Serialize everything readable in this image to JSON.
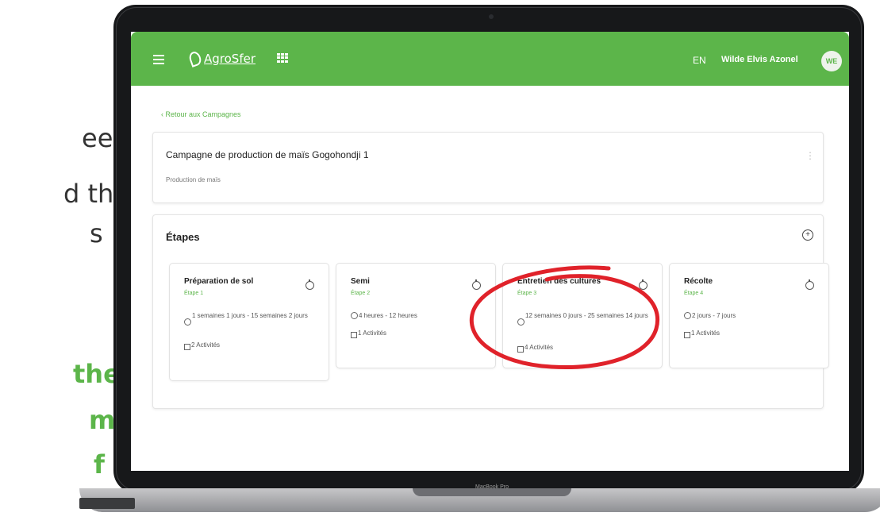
{
  "side_text": {
    "line1": "eer",
    "line2": "d the",
    "line3": "s",
    "line4": "the",
    "line5": "m",
    "line6": "f"
  },
  "colors": {
    "brand_green": "#5cb54a",
    "annotation_red": "#e0222a"
  },
  "laptop": {
    "label": "MacBook Pro"
  },
  "navbar": {
    "menu_icon": "hamburger-menu-icon",
    "logo_text": "AgroSfer",
    "apps_icon": "grid-apps-icon",
    "language": "EN",
    "user_name": "Wilde Elvis Azonel",
    "avatar_initials": "WE"
  },
  "back_link": "‹ Retour aux Campagnes",
  "campaign": {
    "title": "Campagne de production de maïs Gogohondji 1",
    "subtitle": "Production de maïs",
    "menu_icon": "kebab-menu-icon"
  },
  "steps": {
    "title": "Étapes",
    "add_icon": "add-circle-icon",
    "items": [
      {
        "name": "Préparation de sol",
        "sub": "Étape 1",
        "duration": "1 semaines 1 jours - 15 semaines 2 jours",
        "activities": "2 Activités"
      },
      {
        "name": "Semi",
        "sub": "Étape 2",
        "duration": "4 heures - 12 heures",
        "activities": "1 Activités"
      },
      {
        "name": "Entretien des cultures",
        "sub": "Étape 3",
        "duration": "12 semaines 0 jours - 25 semaines 14 jours",
        "activities": "4 Activités"
      },
      {
        "name": "Récolte",
        "sub": "Étape 4",
        "duration": "2 jours - 7 jours",
        "activities": "1 Activités"
      }
    ]
  }
}
